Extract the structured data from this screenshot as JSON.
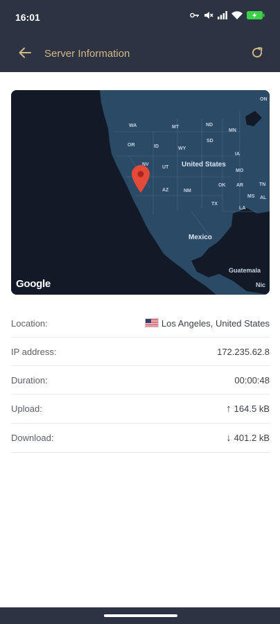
{
  "status_bar": {
    "time": "16:01",
    "icons": [
      "key-icon",
      "mute-icon",
      "signal-icon",
      "wifi-icon",
      "battery-charging-icon"
    ]
  },
  "app_bar": {
    "title": "Server Information",
    "back_icon": "back-arrow-icon",
    "refresh_icon": "refresh-icon"
  },
  "map": {
    "logo": "Google",
    "labels": {
      "wa": "WA",
      "mt": "MT",
      "nd": "ND",
      "mn": "MN",
      "or": "OR",
      "id": "ID",
      "sd": "SD",
      "wy": "WY",
      "ia": "IA",
      "nv": "NV",
      "ut": "UT",
      "united_states": "United States",
      "mo": "MO",
      "ok": "OK",
      "ar": "AR",
      "az": "AZ",
      "nm": "NM",
      "tn": "TN",
      "tx": "TX",
      "la": "LA",
      "ms": "MS",
      "al": "AL",
      "mexico": "Mexico",
      "guatemala": "Guatemala",
      "nic": "Nic",
      "on": "ON"
    },
    "marker_icon": "map-pin-icon"
  },
  "server_info": {
    "location": {
      "label": "Location:",
      "value": "Los Angeles, United States",
      "flag": "us-flag-icon"
    },
    "ip_address": {
      "label": "IP address:",
      "value": "172.235.62.8"
    },
    "duration": {
      "label": "Duration:",
      "value": "00:00:48"
    },
    "upload": {
      "label": "Upload:",
      "value": "164.5 kB",
      "arrow": "↑"
    },
    "download": {
      "label": "Download:",
      "value": "401.2 kB",
      "arrow": "↓"
    }
  },
  "colors": {
    "header_bg": "#2c3444",
    "accent": "#d4b787",
    "map_bg": "#121a28",
    "land": "#2a4a66",
    "marker": "#e5493a"
  }
}
